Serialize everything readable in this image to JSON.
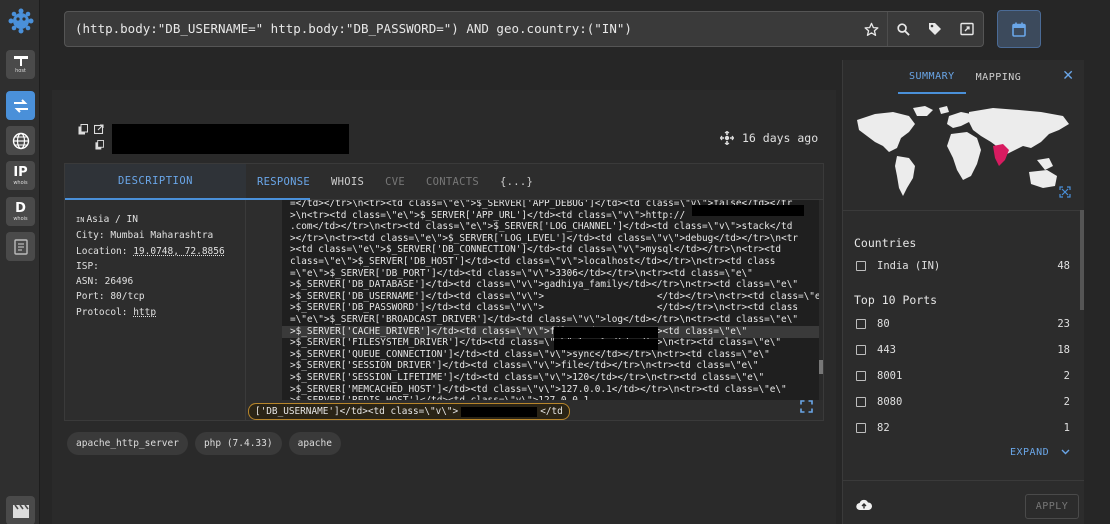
{
  "search": {
    "query": "(http.body:\"DB_USERNAME=\" http.body:\"DB_PASSWORD=\") AND geo.country:(\"IN\")"
  },
  "rail": {
    "host_label": "host",
    "ip_label": "IP",
    "ip_sub": "whois",
    "d_label": "D",
    "d_sub": "whois"
  },
  "header": {
    "time_ago": "16 days ago"
  },
  "desc": {
    "tab": "DESCRIPTION",
    "country_code": "IN",
    "region": "Asia / IN",
    "city": "City: Mumbai Maharashtra",
    "location_prefix": "Location: ",
    "location": "19.0748, 72.8856",
    "isp": "ISP:",
    "asn": "ASN: 26496",
    "port": "Port: 80/tcp",
    "protocol_prefix": "Protocol: ",
    "protocol": "http"
  },
  "tabs": {
    "response": "RESPONSE",
    "whois": "WHOIS",
    "cve": "CVE",
    "contacts": "CONTACTS",
    "json": "{...}"
  },
  "code_lines": [
    "=</td></tr>\\n<tr><td class=\\\"e\\\">$_SERVER['APP_DEBUG']</td><td class=\\\"v\\\">false</td></tr",
    ">\\n<tr><td class=\\\"e\\\">$_SERVER['APP_URL']</td><td class=\\\"v\\\">http://",
    ".com</td></tr>\\n<tr><td class=\\\"e\\\">$_SERVER['LOG_CHANNEL']</td><td class=\\\"v\\\">stack</td",
    "></tr>\\n<tr><td class=\\\"e\\\">$_SERVER['LOG_LEVEL']</td><td class=\\\"v\\\">debug</td></tr>\\n<tr",
    "><td class=\\\"e\\\">$_SERVER['DB_CONNECTION']</td><td class=\\\"v\\\">mysql</td></tr>\\n<tr><td",
    "class=\\\"e\\\">$_SERVER['DB_HOST']</td><td class=\\\"v\\\">localhost</td></tr>\\n<tr><td class",
    "=\\\"e\\\">$_SERVER['DB_PORT']</td><td class=\\\"v\\\">3306</td></tr>\\n<tr><td class=\\\"e\\\"",
    ">$_SERVER['DB_DATABASE']</td><td class=\\\"v\\\">gadhiya_family</td></tr>\\n<tr><td class=\\\"e\\\"",
    ">$_SERVER['DB_USERNAME']</td><td class=\\\"v\\\">                    </td></tr>\\n<tr><td class=\\\"e\\\"",
    ">$_SERVER['DB_PASSWORD']</td><td class=\\\"v\\\">                    </td></tr>\\n<tr><td class",
    "=\\\"e\\\">$_SERVER['BROADCAST_DRIVER']</td><td class=\\\"v\\\">log</td></tr>\\n<tr><td class=\\\"e\\\"",
    ">$_SERVER['CACHE_DRIVER']</td><td class=\\\"v\\\">file</td></tr>\\n<tr><td class=\\\"e\\\"",
    ">$_SERVER['FILESYSTEM_DRIVER']</td><td class=\\\"v\\\">local</td></tr>\\n<tr><td class=\\\"e\\\"",
    ">$_SERVER['QUEUE_CONNECTION']</td><td class=\\\"v\\\">sync</td></tr>\\n<tr><td class=\\\"e\\\"",
    ">$_SERVER['SESSION_DRIVER']</td><td class=\\\"v\\\">file</td></tr>\\n<tr><td class=\\\"e\\\"",
    ">$_SERVER['SESSION_LIFETIME']</td><td class=\\\"v\\\">120</td></tr>\\n<tr><td class=\\\"e\\\"",
    ">$_SERVER['MEMCACHED_HOST']</td><td class=\\\"v\\\">127.0.0.1</td></tr>\\n<tr><td class=\\\"e\\\"",
    ">$_SERVER['REDIS_HOST']</td><td class=\\\"v\\\">127.0.0.1"
  ],
  "match": {
    "before": "['DB_USERNAME']</td><td class=\\\"v\\\">",
    "after": "</td"
  },
  "tags": [
    "apache_http_server",
    "php (7.4.33)",
    "apache"
  ],
  "summary": {
    "tab_summary": "SUMMARY",
    "tab_mapping": "MAPPING",
    "countries_title": "Countries",
    "countries": [
      {
        "name": "India (IN)",
        "count": "48"
      }
    ],
    "ports_title": "Top 10 Ports",
    "ports": [
      {
        "name": "80",
        "count": "23"
      },
      {
        "name": "443",
        "count": "18"
      },
      {
        "name": "8001",
        "count": "2"
      },
      {
        "name": "8080",
        "count": "2"
      },
      {
        "name": "82",
        "count": "1"
      }
    ],
    "expand": "EXPAND",
    "apply": "APPLY"
  },
  "colors": {
    "accent": "#4a90d9",
    "highlight_country": "#d81b60",
    "match_border": "#b8862b"
  }
}
